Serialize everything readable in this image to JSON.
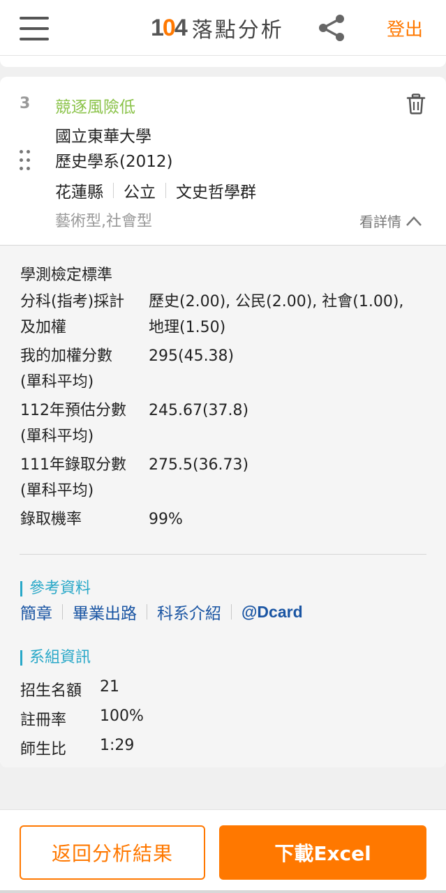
{
  "header": {
    "logo_num": "104",
    "logo_text": "落點分析",
    "logout_label": "登出",
    "icons": {
      "menu": "hamburger-menu-icon",
      "share": "share-icon"
    }
  },
  "card": {
    "rank": "3",
    "risk_label": "競逐風險低",
    "school": "國立東華大學",
    "department": "歷史學系(2012)",
    "tags": [
      "花蓮縣",
      "公立",
      "文史哲學群"
    ],
    "traits": "藝術型,社會型",
    "detail_toggle": "看詳情",
    "icons": {
      "delete": "trash-icon",
      "drag": "drag-handle-icon",
      "toggle": "chevron-up-icon"
    }
  },
  "details": {
    "title": "學測檢定標準",
    "rows": [
      {
        "label_line1": "分科(指考)採計",
        "label_line2": "及加權",
        "value_line1": "歷史(2.00), 公民(2.00), 社會(1.00),",
        "value_line2": "地理(1.50)"
      },
      {
        "label_line1": "我的加權分數",
        "label_line2": "(單科平均)",
        "value_line1": "295(45.38)"
      },
      {
        "label_line1": "112年預估分數",
        "label_line2": "(單科平均)",
        "value_line1": "245.67(37.8)"
      },
      {
        "label_line1": "111年錄取分數",
        "label_line2": "(單科平均)",
        "value_line1": "275.5(36.73)"
      },
      {
        "label_line1": "錄取機率",
        "value_line1": "99%"
      }
    ]
  },
  "reference": {
    "title": "參考資料",
    "links": [
      "簡章",
      "畢業出路",
      "科系介紹",
      "@Dcard"
    ]
  },
  "dept_info": {
    "title": "系組資訊",
    "items": [
      {
        "label": "招生名額",
        "value": "21"
      },
      {
        "label": "註冊率",
        "value": "100%"
      },
      {
        "label": "師生比",
        "value": "1:29"
      }
    ]
  },
  "footer": {
    "back_label": "返回分析結果",
    "excel_label": "下載Excel"
  },
  "colors": {
    "brand_orange": "#ff7800",
    "risk_green": "#8bc34a",
    "section_teal": "#29a8c8",
    "link_blue": "#1a55a3"
  }
}
